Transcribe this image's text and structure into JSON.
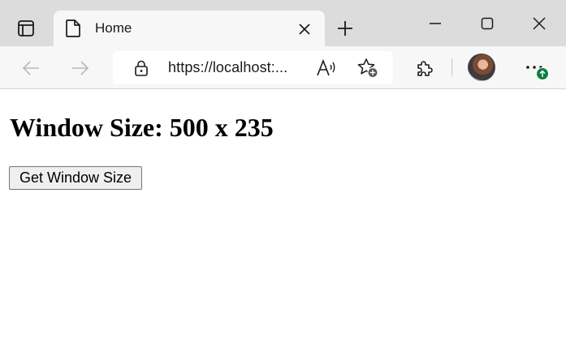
{
  "tab": {
    "title": "Home"
  },
  "address_bar": {
    "url": "https://localhost:..."
  },
  "page": {
    "heading": "Window Size: 500 x 235",
    "button_label": "Get Window Size"
  },
  "icons": {
    "tab_actions": "tab-actions-icon",
    "page": "page-icon",
    "close_tab": "close-icon",
    "new_tab": "plus-icon",
    "minimize": "minimize-icon",
    "maximize": "maximize-icon",
    "close_window": "close-icon",
    "back": "arrow-left-icon",
    "forward": "arrow-right-icon",
    "lock": "lock-icon",
    "read_aloud": "read-aloud-icon",
    "favorites": "add-favorite-icon",
    "extensions": "puzzle-icon",
    "more": "more-icon",
    "update": "arrow-up-icon"
  },
  "colors": {
    "tab_strip": "#dcdcdc",
    "toolbar": "#f7f7f7",
    "update_badge": "#107c41"
  }
}
